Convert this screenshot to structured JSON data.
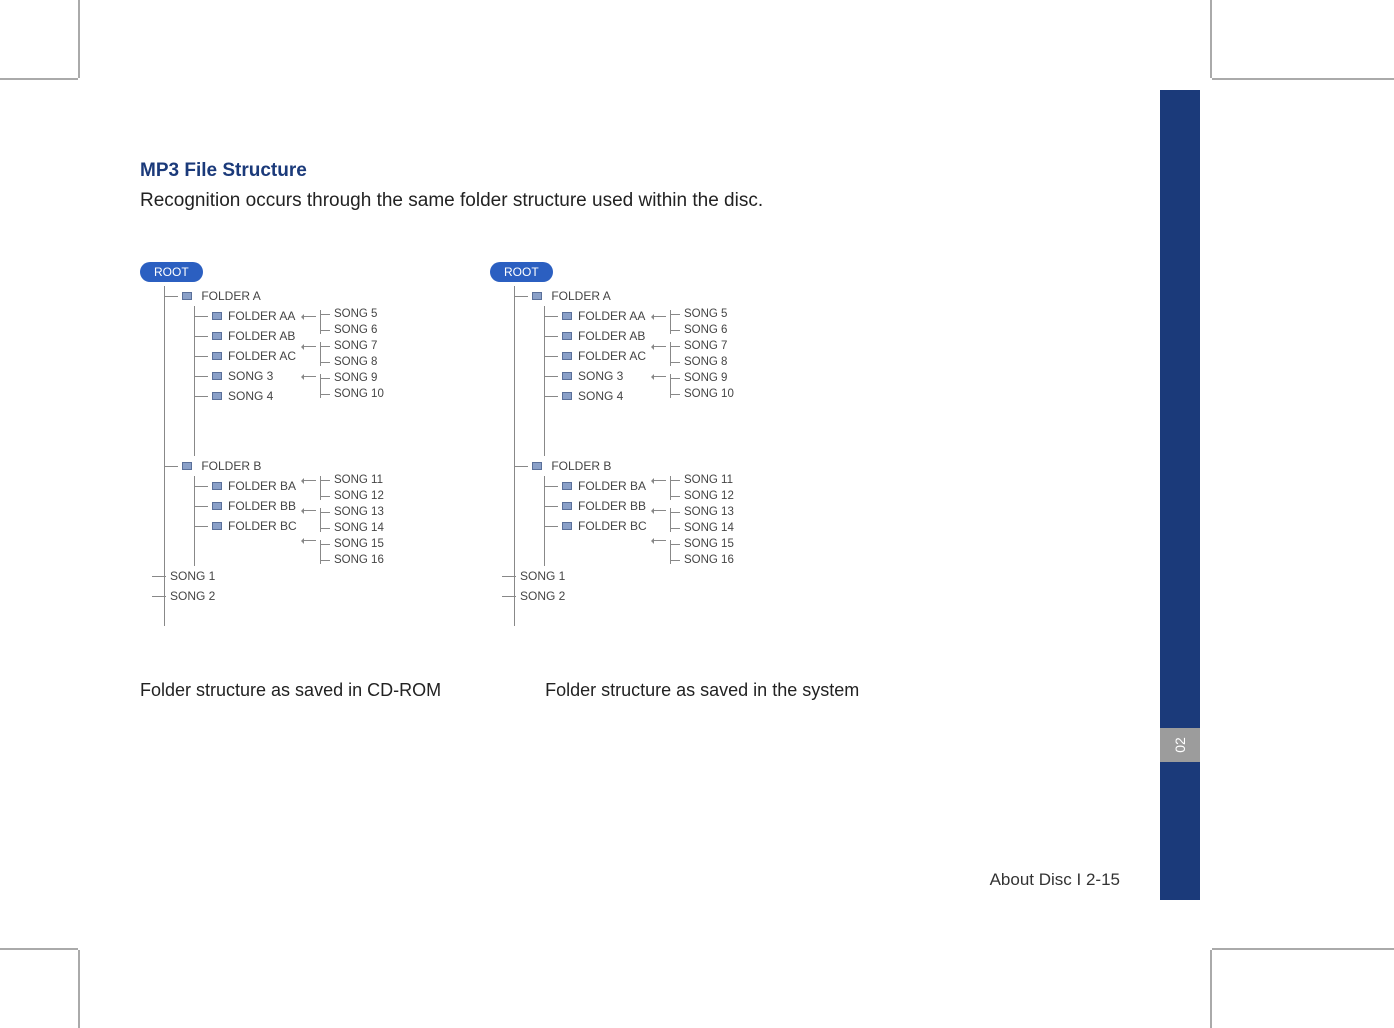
{
  "section": {
    "title": "MP3 File Structure",
    "description": "Recognition occurs through the same folder structure used within the disc."
  },
  "diagram": {
    "root_label": "ROOT",
    "tree": {
      "folder_a": "FOLDER A",
      "folder_aa": "FOLDER AA",
      "folder_ab": "FOLDER AB",
      "folder_ac": "FOLDER AC",
      "song3": "SONG 3",
      "song4": "SONG 4",
      "folder_b": "FOLDER B",
      "folder_ba": "FOLDER BA",
      "folder_bb": "FOLDER BB",
      "folder_bc": "FOLDER BC",
      "song1": "SONG 1",
      "song2": "SONG 2",
      "songs_aa_1": "SONG 5",
      "songs_aa_2": "SONG 6",
      "songs_ab_1": "SONG 7",
      "songs_ab_2": "SONG 8",
      "songs_ac_1": "SONG 9",
      "songs_ac_2": "SONG 10",
      "songs_ba_1": "SONG 11",
      "songs_ba_2": "SONG 12",
      "songs_bb_1": "SONG 13",
      "songs_bb_2": "SONG 14",
      "songs_bc_1": "SONG 15",
      "songs_bc_2": "SONG 16"
    },
    "caption_left": "Folder structure as saved in CD-ROM",
    "caption_right": "Folder structure as saved in the system"
  },
  "footer": {
    "text": "About Disc I 2-15"
  },
  "sidebar": {
    "section_number": "02"
  }
}
